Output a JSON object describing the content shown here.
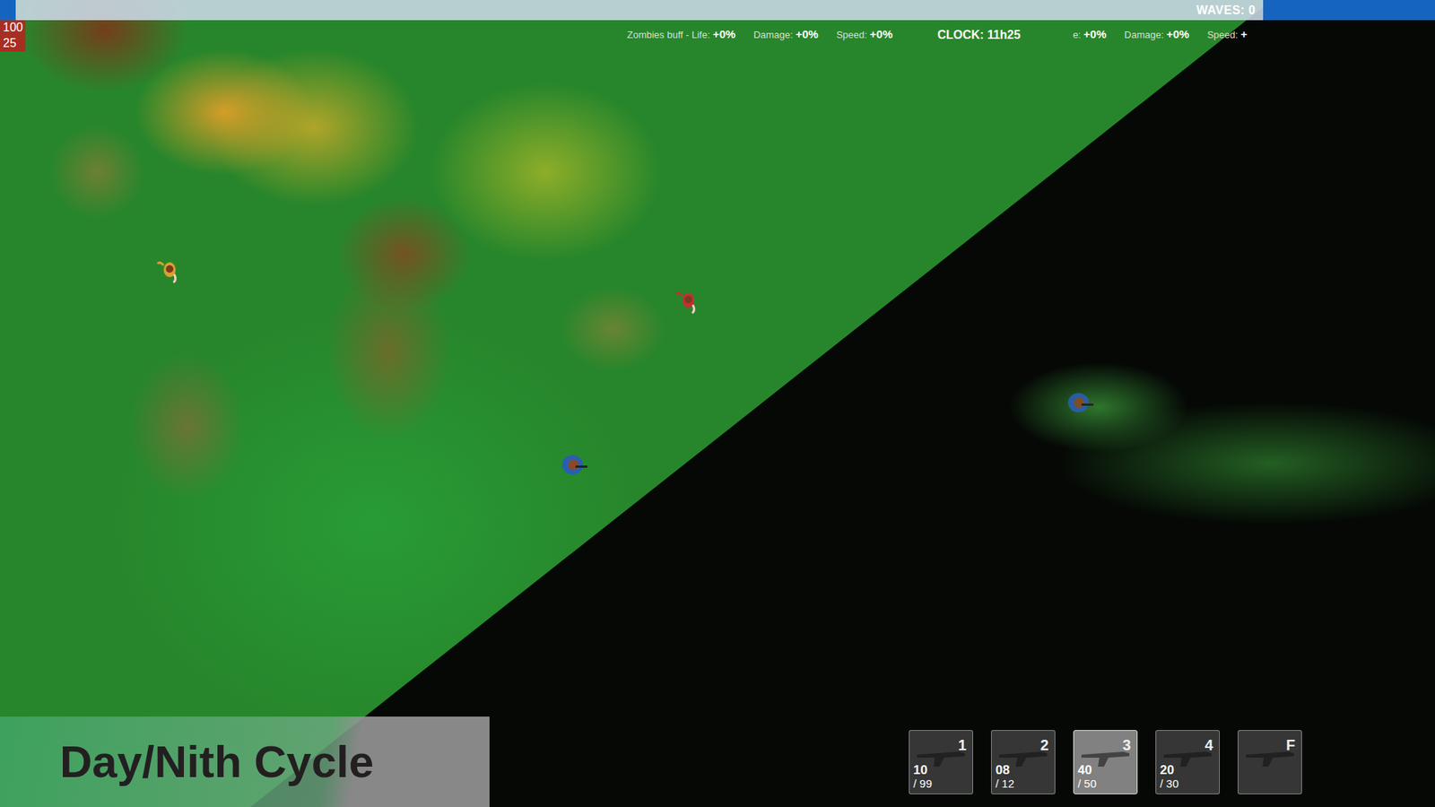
{
  "top_bar": {
    "level": 0.013,
    "waves_label": "WAVES: 0"
  },
  "player_stats": [
    {
      "value": "100"
    },
    {
      "value": "25"
    }
  ],
  "day_buffs": [
    {
      "label": "Zombies buff - Life:",
      "value": "+0%"
    },
    {
      "label": "Damage:",
      "value": "+0%"
    },
    {
      "label": "Speed:",
      "value": "+0%"
    }
  ],
  "clock": "CLOCK: 11h25",
  "night_buffs": [
    {
      "label": "e:",
      "value": "+0%"
    },
    {
      "label": "Damage:",
      "value": "+0%"
    },
    {
      "label": "Speed:",
      "value": "+"
    }
  ],
  "characters": [
    {
      "kind": "zombie",
      "color": "#d9a030"
    },
    {
      "kind": "zombie",
      "color": "#c23030"
    },
    {
      "kind": "player",
      "color": "#2a5fb0"
    },
    {
      "kind": "player",
      "color": "#2a5fb0"
    }
  ],
  "weapons": [
    {
      "key": "1",
      "ammo": "10",
      "max": "/ 99",
      "selected": false
    },
    {
      "key": "2",
      "ammo": "08",
      "max": "/ 12",
      "selected": false
    },
    {
      "key": "3",
      "ammo": "40",
      "max": "/ 50",
      "selected": true
    },
    {
      "key": "4",
      "ammo": "20",
      "max": "/ 30",
      "selected": false
    },
    {
      "key": "F",
      "ammo": "",
      "max": "",
      "selected": false
    }
  ],
  "caption": "Day/Nith Cycle"
}
